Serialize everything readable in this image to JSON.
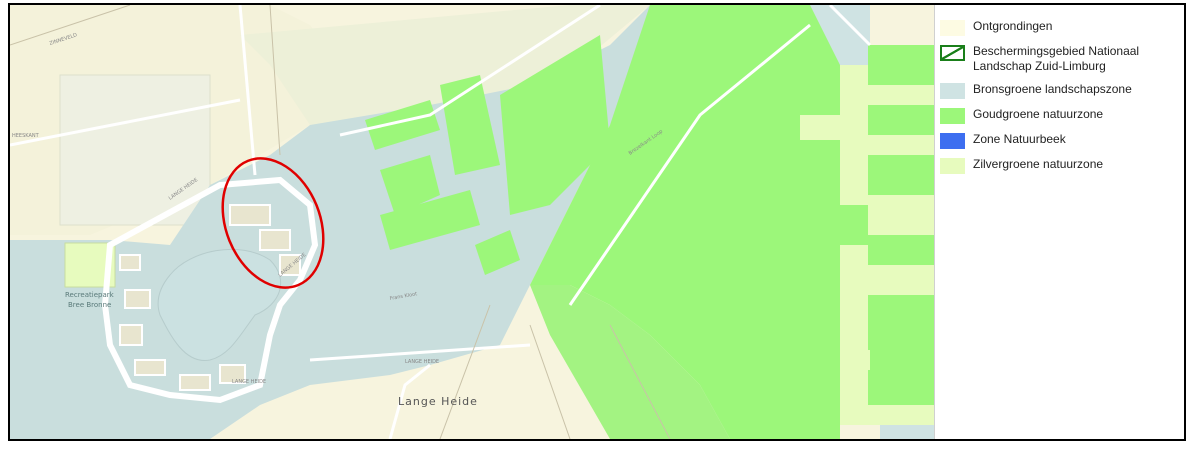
{
  "map": {
    "place_label_main": "Lange Heide",
    "park_label_line1": "Recreatiepark",
    "park_label_line2": "Bree Bronne",
    "road_labels": {
      "zinneveld": "ZINNEVELD",
      "lange_heide_1": "LANGE HEIDE",
      "lange_heide_2": "LANGE HEIDE",
      "lange_heide_3": "LANGE HEIDE",
      "lange_heide_4": "LANGE HEIDE",
      "heeskant": "HEESKANT",
      "frans_kloot": "Frans Kloot",
      "brezelkant": "Brezelkant Loop"
    },
    "highlight_color": "#e00000"
  },
  "legend": {
    "items": [
      {
        "label": "Ontgrondingen",
        "color": "#fdfbe3"
      },
      {
        "label": "Beschermingsgebied Nationaal\nLandschap Zuid-Limburg",
        "color": "#1a7f1a"
      },
      {
        "label": "Bronsgroene landschapszone",
        "color": "#cfe3e3"
      },
      {
        "label": "Goudgroene natuurzone",
        "color": "#9cf77a"
      },
      {
        "label": "Zone Natuurbeek",
        "color": "#3d6ef0"
      },
      {
        "label": "Zilvergroene natuurzone",
        "color": "#e7fbbe"
      }
    ]
  }
}
